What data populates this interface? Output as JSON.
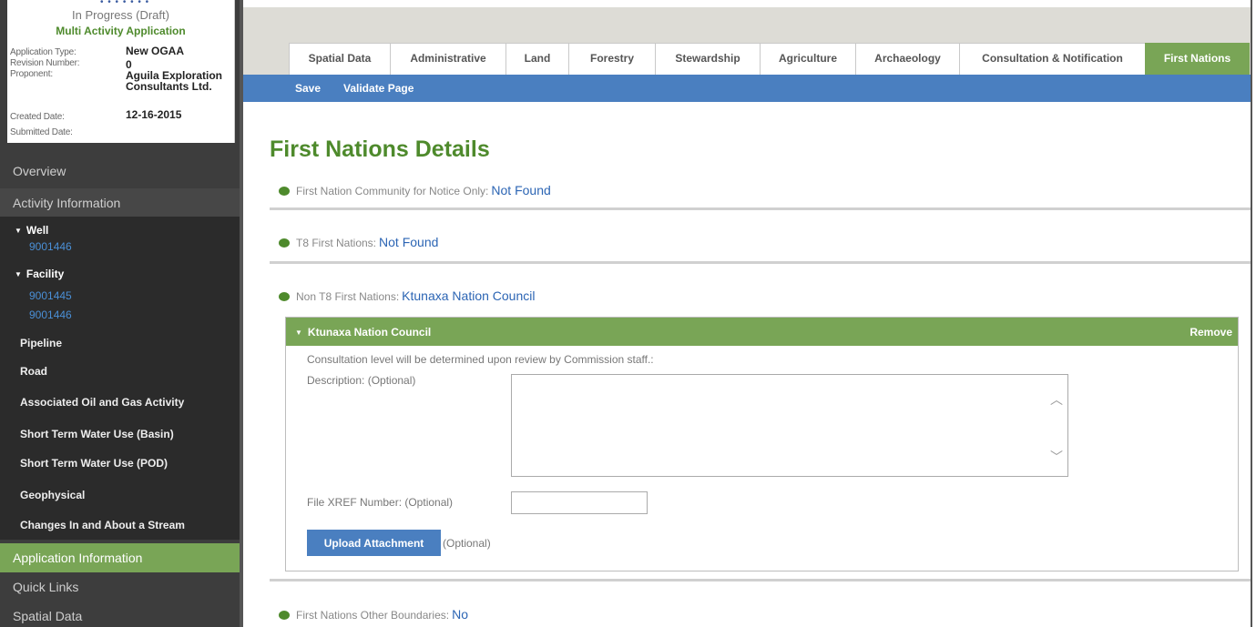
{
  "sidebar": {
    "status": "In Progress (Draft)",
    "app_kind": "Multi Activity Application",
    "info": {
      "application_type_label": "Application Type:",
      "application_type": "New OGAA",
      "revision_label": "Revision Number:",
      "revision": "0",
      "proponent_label": "Proponent:",
      "proponent_line1": "Aguila Exploration",
      "proponent_line2": "Consultants Ltd.",
      "created_label": "Created Date:",
      "created": "12-16-2015",
      "submitted_label": "Submitted Date:"
    },
    "overview": "Overview",
    "activity_information": "Activity Information",
    "well": "Well",
    "well_links": [
      "9001446"
    ],
    "facility": "Facility",
    "facility_links": [
      "9001445",
      "9001446"
    ],
    "items": [
      "Pipeline",
      "Road",
      "Associated Oil and Gas Activity",
      "Short Term Water Use (Basin)",
      "Short Term Water Use (POD)",
      "Geophysical",
      "Changes In and About a Stream"
    ],
    "application_information": "Application Information",
    "quick_links": "Quick Links",
    "spatial_data": "Spatial Data"
  },
  "tabs": [
    "Spatial Data",
    "Administrative",
    "Land",
    "Forestry",
    "Stewardship",
    "Agriculture",
    "Archaeology",
    "Consultation & Notification",
    "First Nations"
  ],
  "active_tab": "First Nations",
  "toolbar": {
    "save": "Save",
    "validate": "Validate Page"
  },
  "main": {
    "title": "First Nations Details",
    "notice_label": "First Nation Community for Notice Only:",
    "notice_value": "Not Found",
    "t8_label": "T8 First Nations:",
    "t8_value": "Not Found",
    "non_t8_label": "Non T8 First Nations:",
    "non_t8_value": "Ktunaxa Nation Council",
    "panel": {
      "title": "Ktunaxa Nation Council",
      "remove": "Remove",
      "consultation_note": "Consultation level will be determined upon review by Commission staff.:",
      "description_label": "Description: (Optional)",
      "xref_label": "File XREF Number: (Optional)",
      "upload_button": "Upload Attachment",
      "upload_optional": "(Optional)"
    },
    "other_boundaries_label": "First Nations Other Boundaries:",
    "other_boundaries_value": "No"
  },
  "colors": {
    "accent_green": "#79a556",
    "title_green": "#4e8a2c",
    "toolbar_blue": "#4a7fc0",
    "link_blue": "#2c65b4"
  }
}
